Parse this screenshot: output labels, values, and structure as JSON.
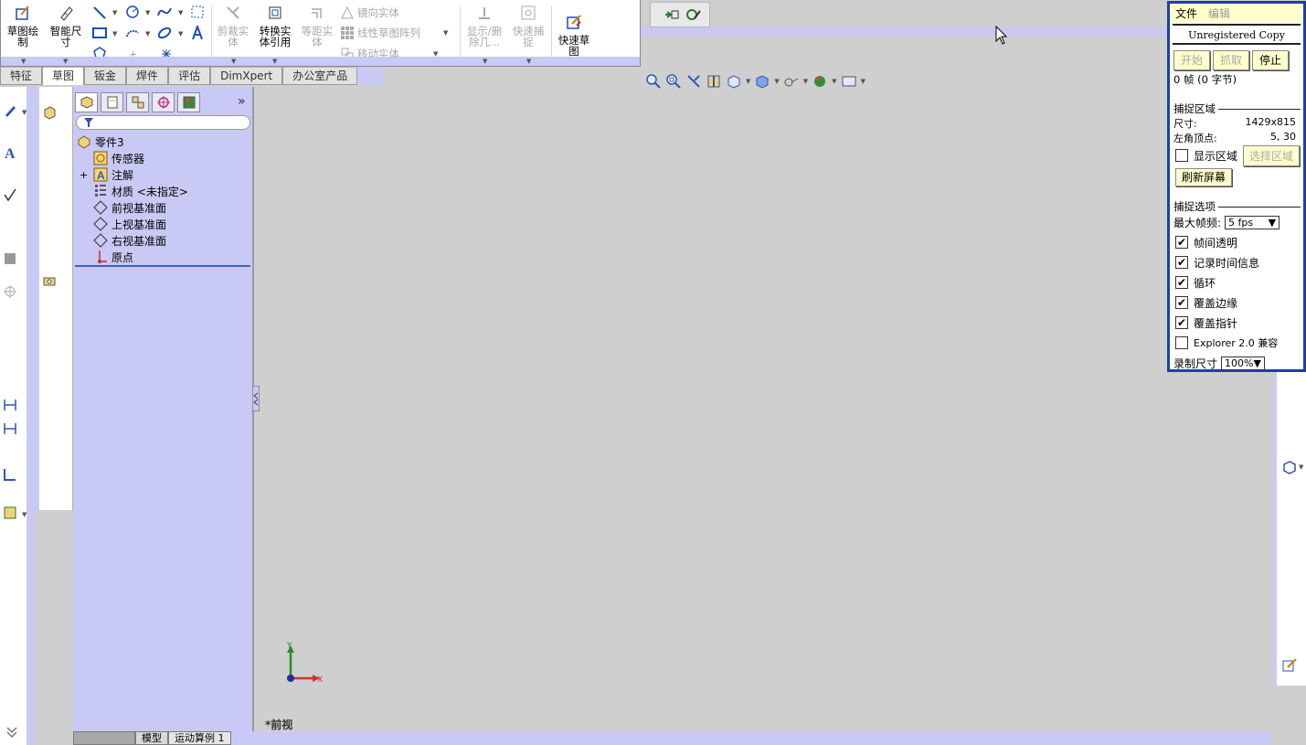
{
  "command_manager": {
    "sketch_btn": "草图绘制",
    "smart_dim_btn": "智能尺寸",
    "trim_btn": "剪裁实体",
    "convert_btn": "转换实体引用",
    "offset_btn": "等距实体",
    "mirror_label": "镜向实体",
    "linear_pattern_label": "线性草图阵列",
    "move_label": "移动实体",
    "show_delete_btn": "显示/删除几...",
    "quick_snap_btn": "快速捕捉",
    "quick_sketch_btn": "快速草图"
  },
  "tabs": [
    "特征",
    "草图",
    "钣金",
    "焊件",
    "评估",
    "DimXpert",
    "办公室产品"
  ],
  "active_tab": "草图",
  "feature_tree": {
    "expand_glyph": "»",
    "items": [
      {
        "label": "零件3",
        "icon": "part-icon"
      },
      {
        "label": "传感器",
        "icon": "sensor-icon"
      },
      {
        "label": "注解",
        "icon": "annotation-icon",
        "expand": "+"
      },
      {
        "label": "材质 <未指定>",
        "icon": "material-icon"
      },
      {
        "label": "前视基准面",
        "icon": "plane-icon"
      },
      {
        "label": "上视基准面",
        "icon": "plane-icon"
      },
      {
        "label": "右视基准面",
        "icon": "plane-icon"
      },
      {
        "label": "原点",
        "icon": "origin-icon"
      }
    ]
  },
  "bottom_tabs": [
    "模型",
    "运动算例 1"
  ],
  "view_label": "*前视",
  "triad": {
    "x": "X",
    "y": "Y"
  },
  "capture_panel": {
    "menu_file": "文件",
    "menu_edit": "编辑",
    "unregistered": "Unregistered Copy",
    "btn_start": "开始",
    "btn_grab": "抓取",
    "btn_stop": "停止",
    "frames": "0 帧 (0 字节)",
    "section_area": "捕捉区域",
    "size_label": "尺寸:",
    "size_value": "1429x815",
    "corner_label": "左角顶点:",
    "corner_value": "5, 30",
    "show_area": "显示区域",
    "select_area": "选择区域",
    "refresh": "刷新屏幕",
    "section_options": "捕捉选项",
    "max_fps_label": "最大帧频:",
    "max_fps_value": "5 fps",
    "opt_transparent": "帧间透明",
    "opt_timing": "记录时间信息",
    "opt_loop": "循环",
    "opt_border": "覆盖边缘",
    "opt_pointer": "覆盖指针",
    "opt_explorer": "Explorer 2.0 兼容",
    "rec_size_label": "录制尺寸",
    "rec_size_value": "100%"
  },
  "colors": {
    "lavender": "#c9c9f6",
    "panel_border": "#1f3fa6",
    "yellow": "#ffffcc"
  }
}
